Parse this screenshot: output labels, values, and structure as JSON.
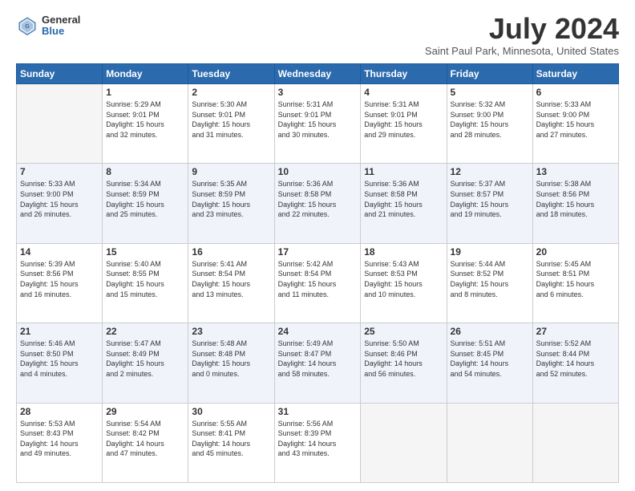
{
  "logo": {
    "general": "General",
    "blue": "Blue"
  },
  "title": "July 2024",
  "location": "Saint Paul Park, Minnesota, United States",
  "days_of_week": [
    "Sunday",
    "Monday",
    "Tuesday",
    "Wednesday",
    "Thursday",
    "Friday",
    "Saturday"
  ],
  "weeks": [
    [
      {
        "num": "",
        "info": ""
      },
      {
        "num": "1",
        "info": "Sunrise: 5:29 AM\nSunset: 9:01 PM\nDaylight: 15 hours\nand 32 minutes."
      },
      {
        "num": "2",
        "info": "Sunrise: 5:30 AM\nSunset: 9:01 PM\nDaylight: 15 hours\nand 31 minutes."
      },
      {
        "num": "3",
        "info": "Sunrise: 5:31 AM\nSunset: 9:01 PM\nDaylight: 15 hours\nand 30 minutes."
      },
      {
        "num": "4",
        "info": "Sunrise: 5:31 AM\nSunset: 9:01 PM\nDaylight: 15 hours\nand 29 minutes."
      },
      {
        "num": "5",
        "info": "Sunrise: 5:32 AM\nSunset: 9:00 PM\nDaylight: 15 hours\nand 28 minutes."
      },
      {
        "num": "6",
        "info": "Sunrise: 5:33 AM\nSunset: 9:00 PM\nDaylight: 15 hours\nand 27 minutes."
      }
    ],
    [
      {
        "num": "7",
        "info": "Sunrise: 5:33 AM\nSunset: 9:00 PM\nDaylight: 15 hours\nand 26 minutes."
      },
      {
        "num": "8",
        "info": "Sunrise: 5:34 AM\nSunset: 8:59 PM\nDaylight: 15 hours\nand 25 minutes."
      },
      {
        "num": "9",
        "info": "Sunrise: 5:35 AM\nSunset: 8:59 PM\nDaylight: 15 hours\nand 23 minutes."
      },
      {
        "num": "10",
        "info": "Sunrise: 5:36 AM\nSunset: 8:58 PM\nDaylight: 15 hours\nand 22 minutes."
      },
      {
        "num": "11",
        "info": "Sunrise: 5:36 AM\nSunset: 8:58 PM\nDaylight: 15 hours\nand 21 minutes."
      },
      {
        "num": "12",
        "info": "Sunrise: 5:37 AM\nSunset: 8:57 PM\nDaylight: 15 hours\nand 19 minutes."
      },
      {
        "num": "13",
        "info": "Sunrise: 5:38 AM\nSunset: 8:56 PM\nDaylight: 15 hours\nand 18 minutes."
      }
    ],
    [
      {
        "num": "14",
        "info": "Sunrise: 5:39 AM\nSunset: 8:56 PM\nDaylight: 15 hours\nand 16 minutes."
      },
      {
        "num": "15",
        "info": "Sunrise: 5:40 AM\nSunset: 8:55 PM\nDaylight: 15 hours\nand 15 minutes."
      },
      {
        "num": "16",
        "info": "Sunrise: 5:41 AM\nSunset: 8:54 PM\nDaylight: 15 hours\nand 13 minutes."
      },
      {
        "num": "17",
        "info": "Sunrise: 5:42 AM\nSunset: 8:54 PM\nDaylight: 15 hours\nand 11 minutes."
      },
      {
        "num": "18",
        "info": "Sunrise: 5:43 AM\nSunset: 8:53 PM\nDaylight: 15 hours\nand 10 minutes."
      },
      {
        "num": "19",
        "info": "Sunrise: 5:44 AM\nSunset: 8:52 PM\nDaylight: 15 hours\nand 8 minutes."
      },
      {
        "num": "20",
        "info": "Sunrise: 5:45 AM\nSunset: 8:51 PM\nDaylight: 15 hours\nand 6 minutes."
      }
    ],
    [
      {
        "num": "21",
        "info": "Sunrise: 5:46 AM\nSunset: 8:50 PM\nDaylight: 15 hours\nand 4 minutes."
      },
      {
        "num": "22",
        "info": "Sunrise: 5:47 AM\nSunset: 8:49 PM\nDaylight: 15 hours\nand 2 minutes."
      },
      {
        "num": "23",
        "info": "Sunrise: 5:48 AM\nSunset: 8:48 PM\nDaylight: 15 hours\nand 0 minutes."
      },
      {
        "num": "24",
        "info": "Sunrise: 5:49 AM\nSunset: 8:47 PM\nDaylight: 14 hours\nand 58 minutes."
      },
      {
        "num": "25",
        "info": "Sunrise: 5:50 AM\nSunset: 8:46 PM\nDaylight: 14 hours\nand 56 minutes."
      },
      {
        "num": "26",
        "info": "Sunrise: 5:51 AM\nSunset: 8:45 PM\nDaylight: 14 hours\nand 54 minutes."
      },
      {
        "num": "27",
        "info": "Sunrise: 5:52 AM\nSunset: 8:44 PM\nDaylight: 14 hours\nand 52 minutes."
      }
    ],
    [
      {
        "num": "28",
        "info": "Sunrise: 5:53 AM\nSunset: 8:43 PM\nDaylight: 14 hours\nand 49 minutes."
      },
      {
        "num": "29",
        "info": "Sunrise: 5:54 AM\nSunset: 8:42 PM\nDaylight: 14 hours\nand 47 minutes."
      },
      {
        "num": "30",
        "info": "Sunrise: 5:55 AM\nSunset: 8:41 PM\nDaylight: 14 hours\nand 45 minutes."
      },
      {
        "num": "31",
        "info": "Sunrise: 5:56 AM\nSunset: 8:39 PM\nDaylight: 14 hours\nand 43 minutes."
      },
      {
        "num": "",
        "info": ""
      },
      {
        "num": "",
        "info": ""
      },
      {
        "num": "",
        "info": ""
      }
    ]
  ],
  "accent_color": "#2a6aad"
}
